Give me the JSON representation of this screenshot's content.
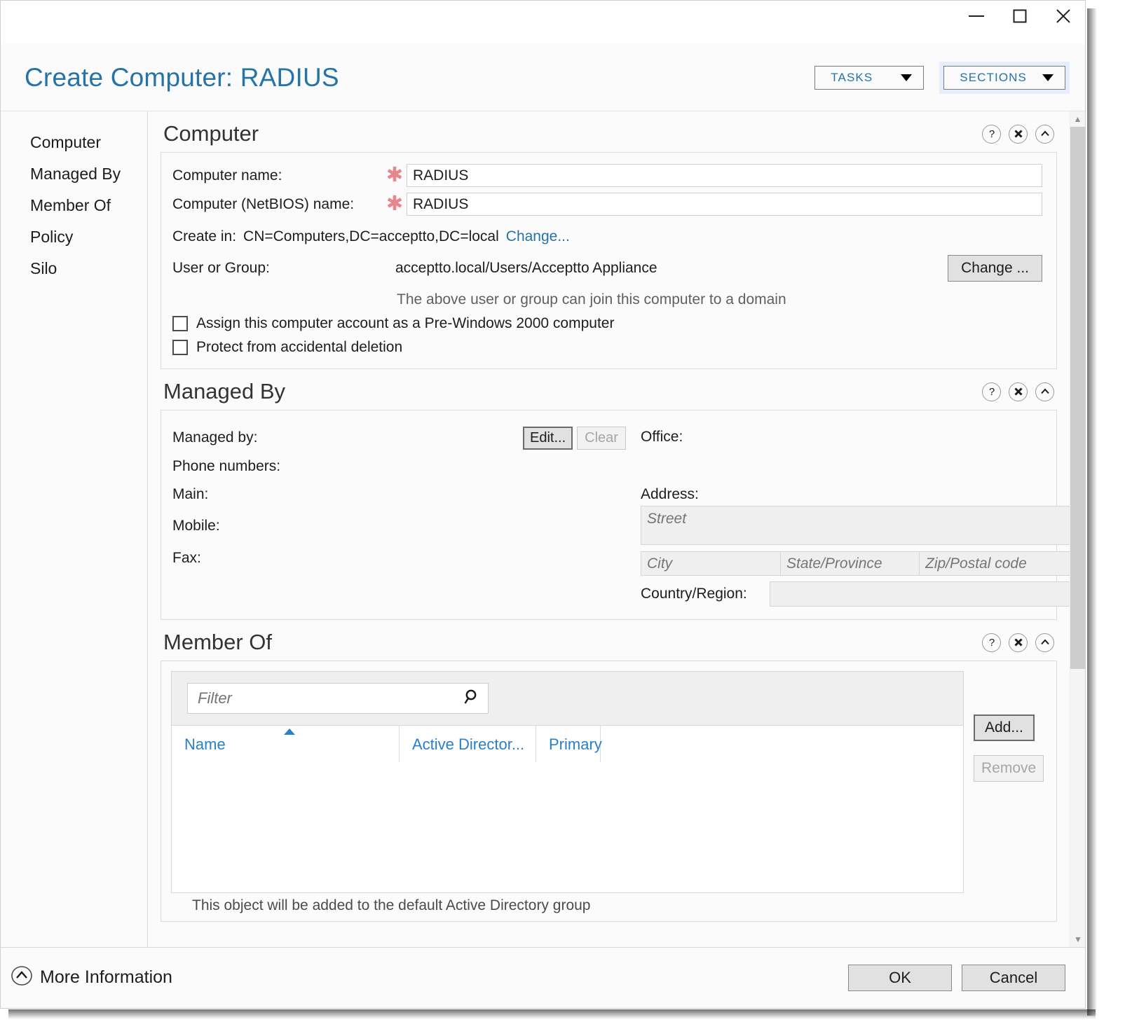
{
  "window": {
    "minimize_label": "Minimize",
    "maximize_label": "Maximize",
    "close_label": "Close"
  },
  "header": {
    "title": "Create Computer: RADIUS",
    "tasks_label": "TASKS",
    "sections_label": "SECTIONS",
    "accent_color": "#2573a7"
  },
  "sidebar": {
    "items": [
      {
        "label": "Computer"
      },
      {
        "label": "Managed By"
      },
      {
        "label": "Member Of"
      },
      {
        "label": "Policy"
      },
      {
        "label": "Silo"
      }
    ]
  },
  "section_icons": {
    "help": "?",
    "close": "✖",
    "collapse": "^"
  },
  "computer_section": {
    "title": "Computer",
    "computer_name_label": "Computer name:",
    "computer_name_value": "RADIUS",
    "netbios_label": "Computer (NetBIOS) name:",
    "netbios_value": "RADIUS",
    "required_marker": "✱",
    "required_color": "#e8868c",
    "create_in_label": "Create in:",
    "create_in_value": "CN=Computers,DC=acceptto,DC=local",
    "create_in_change_link": "Change...",
    "user_or_group_label": "User or Group:",
    "user_or_group_value": "acceptto.local/Users/Acceptto Appliance",
    "user_or_group_change_button": "Change ...",
    "hint": "The above user or group can join this computer to a domain",
    "checkbox_prewindows_label": "Assign this computer account as a Pre-Windows 2000 computer",
    "checkbox_prewindows_checked": false,
    "checkbox_protect_label": "Protect from accidental deletion",
    "checkbox_protect_checked": false
  },
  "managed_by_section": {
    "title": "Managed By",
    "managed_by_label": "Managed by:",
    "managed_by_value": "",
    "edit_button": "Edit...",
    "clear_button": "Clear",
    "phone_numbers_label": "Phone numbers:",
    "main_label": "Main:",
    "main_value": "",
    "mobile_label": "Mobile:",
    "mobile_value": "",
    "fax_label": "Fax:",
    "fax_value": "",
    "office_label": "Office:",
    "office_value": "",
    "address_label": "Address:",
    "street_placeholder": "Street",
    "street_value": "",
    "city_placeholder": "City",
    "city_value": "",
    "state_placeholder": "State/Province",
    "state_value": "",
    "zip_placeholder": "Zip/Postal code",
    "zip_value": "",
    "country_label": "Country/Region:",
    "country_value": ""
  },
  "member_of_section": {
    "title": "Member Of",
    "filter_placeholder": "Filter",
    "filter_value": "",
    "search_icon": "search-icon",
    "columns": [
      {
        "label": "Name",
        "sorted": "asc"
      },
      {
        "label": "Active Director...",
        "sorted": ""
      },
      {
        "label": "Primary",
        "sorted": ""
      },
      {
        "label": "",
        "sorted": ""
      }
    ],
    "rows": [],
    "footer_note": "This object will be added to the default Active Directory group",
    "add_button": "Add...",
    "remove_button": "Remove"
  },
  "footer": {
    "more_information_label": "More Information",
    "ok_label": "OK",
    "cancel_label": "Cancel"
  }
}
